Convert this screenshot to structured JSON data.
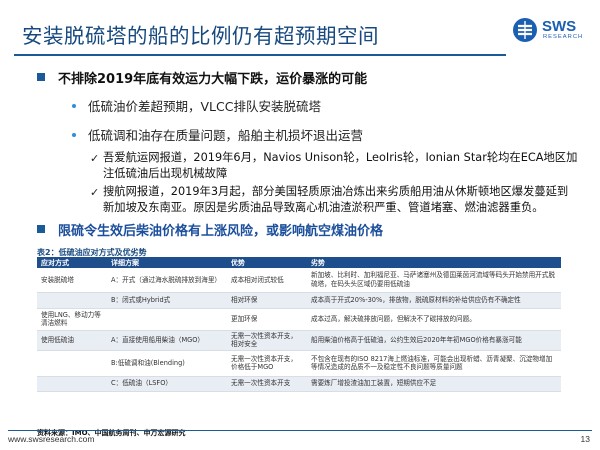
{
  "slide": {
    "title": "安装脱硫塔的船的比例仍有超预期空间",
    "logo": {
      "main": "SWS",
      "sub": "RESEARCH"
    }
  },
  "section1": {
    "heading": "不排除2019年底有效运力大幅下跌，运价暴涨的可能",
    "bullets": [
      "低硫油价差超预期，VLCC排队安装脱硫塔",
      "低硫调和油存在质量问题，船舶主机损坏退出运营"
    ],
    "checks": [
      {
        "lines": [
          "吾爱航运网报道，2019年6月，Navios Unison轮，LeoIris轮，Ionian Star轮均在ECA地区加",
          "注低硫油后出现机械故障"
        ]
      },
      {
        "lines": [
          "搜航网报道，2019年3月起，部分美国轻质原油冶炼出来劣质船用油从休斯顿地区爆发蔓延到",
          "新加坡及东南亚。原因是劣质油品导致离心机油渣淤积严重、管道堵塞、燃油滤器重负。"
        ]
      }
    ]
  },
  "section2": {
    "heading": "限硫令生效后柴油价格有上涨风险，或影响航空煤油价格"
  },
  "table": {
    "caption": "表2：低硫油应对方式及优劣势",
    "headers": [
      "应对方式",
      "详细方案",
      "优势",
      "劣势"
    ],
    "rows": [
      {
        "method": "安装脱硫塔",
        "detail": "A：开式（通过海水脱硫排放到海里）",
        "pro": "成本相对闭式较低",
        "con": "新加坡、比利时、加利福尼亚、马萨诸塞州及德国莱茵河流域等码头开始禁用开式脱硫塔，在码头头区域仍要用低硫油",
        "shade": false
      },
      {
        "method": "",
        "detail": "B：闭式或Hybrid式",
        "pro": "相对环保",
        "con": "成本高于开式20%-30%，排放物，脱硫原材料的补给供应仍有不确定性",
        "shade": true
      },
      {
        "method": "使用LNG、移动力等清洁燃料",
        "detail": "",
        "pro": "更加环保",
        "con": "成本过高，解决硫排放问题，但解决不了碳排放的问题。",
        "shade": false
      },
      {
        "method": "使用低硫油",
        "detail": "A：直接使用船用柴油（MGO）",
        "pro": "无需一次性资本开支，相对安全",
        "con": "船用柴油价格高于低硫油，公约生效后2020年年初MGO价格有暴涨可能",
        "shade": true
      },
      {
        "method": "",
        "detail": "B:低硫调和油(Blending)",
        "pro": "无需一次性资本开支，价格低于MGO",
        "con": "不包含在现有的ISO 8217海上燃油标准，可能会出现析蜡、沥青凝聚、沉淀物增加等情况造成的品质不一及稳定性不良问题等质量问题",
        "shade": false
      },
      {
        "method": "",
        "detail": "C：低硫油（LSFO）",
        "pro": "无需一次性资本开支",
        "con": "需要炼厂增投渣油加工装置，短期供应不足",
        "shade": true
      }
    ],
    "source": "资料来源：IMO、中国航务周刊、申万宏源研究"
  },
  "footer": {
    "url": "www.swsresearch.com",
    "page": "13"
  },
  "colors": {
    "title_blue": "#17497f",
    "accent_blue": "#1b5a98",
    "heading_blue": "#1b4f9c",
    "bullet_blue": "#2f8fd8",
    "table_header": "#1f4e8c",
    "row_shade": "#e9edf4"
  }
}
